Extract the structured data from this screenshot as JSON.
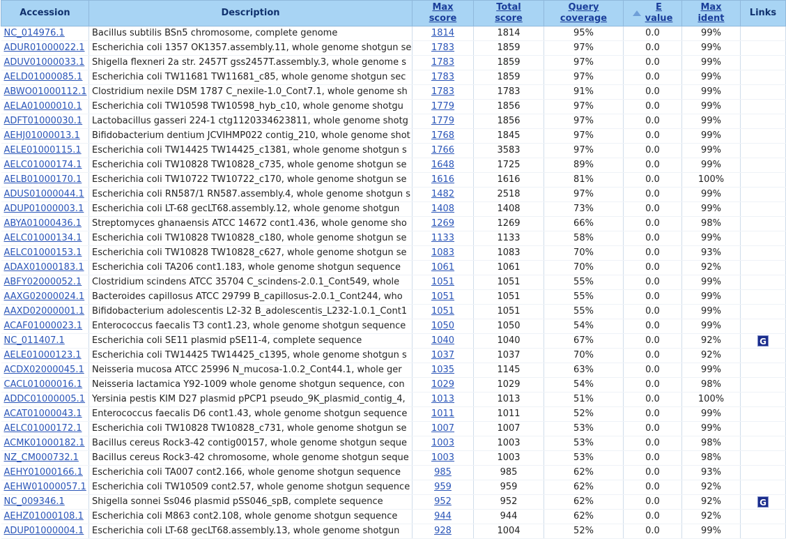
{
  "headers": {
    "accession": "Accession",
    "description": "Description",
    "max_score": [
      "Max",
      "score"
    ],
    "total_score": [
      "Total",
      "score"
    ],
    "query_coverage": [
      "Query",
      "coverage"
    ],
    "e_value": [
      "E",
      "value"
    ],
    "max_ident": [
      "Max",
      "ident"
    ],
    "links": "Links"
  },
  "rows": [
    {
      "accession": "NC_014976.1",
      "description": "Bacillus subtilis BSn5 chromosome, complete genome",
      "max_score": "1814",
      "total_score": "1814",
      "coverage": "95%",
      "evalue": "0.0",
      "ident": "99%",
      "link": ""
    },
    {
      "accession": "ADUR01000022.1",
      "description": "Escherichia coli 1357 OK1357.assembly.11, whole genome shotgun se",
      "max_score": "1783",
      "total_score": "1859",
      "coverage": "97%",
      "evalue": "0.0",
      "ident": "99%",
      "link": ""
    },
    {
      "accession": "ADUV01000033.1",
      "description": "Shigella flexneri 2a str. 2457T gss2457T.assembly.3, whole genome s",
      "max_score": "1783",
      "total_score": "1859",
      "coverage": "97%",
      "evalue": "0.0",
      "ident": "99%",
      "link": ""
    },
    {
      "accession": "AELD01000085.1",
      "description": "Escherichia coli TW11681 TW11681_c85, whole genome shotgun sec",
      "max_score": "1783",
      "total_score": "1859",
      "coverage": "97%",
      "evalue": "0.0",
      "ident": "99%",
      "link": ""
    },
    {
      "accession": "ABWO01000112.1",
      "description": "Clostridium nexile DSM 1787 C_nexile-1.0_Cont7.1, whole genome sh",
      "max_score": "1783",
      "total_score": "1783",
      "coverage": "91%",
      "evalue": "0.0",
      "ident": "99%",
      "link": ""
    },
    {
      "accession": "AELA01000010.1",
      "description": "Escherichia coli TW10598 TW10598_hyb_c10, whole genome shotgu",
      "max_score": "1779",
      "total_score": "1856",
      "coverage": "97%",
      "evalue": "0.0",
      "ident": "99%",
      "link": ""
    },
    {
      "accession": "ADFT01000030.1",
      "description": "Lactobacillus gasseri 224-1 ctg1120334623811, whole genome shotg",
      "max_score": "1779",
      "total_score": "1856",
      "coverage": "97%",
      "evalue": "0.0",
      "ident": "99%",
      "link": ""
    },
    {
      "accession": "AEHJ01000013.1",
      "description": "Bifidobacterium dentium JCVIHMP022 contig_210, whole genome shot",
      "max_score": "1768",
      "total_score": "1845",
      "coverage": "97%",
      "evalue": "0.0",
      "ident": "99%",
      "link": ""
    },
    {
      "accession": "AELE01000115.1",
      "description": "Escherichia coli TW14425 TW14425_c1381, whole genome shotgun s",
      "max_score": "1766",
      "total_score": "3583",
      "coverage": "97%",
      "evalue": "0.0",
      "ident": "99%",
      "link": ""
    },
    {
      "accession": "AELC01000174.1",
      "description": "Escherichia coli TW10828 TW10828_c735, whole genome shotgun se",
      "max_score": "1648",
      "total_score": "1725",
      "coverage": "89%",
      "evalue": "0.0",
      "ident": "99%",
      "link": ""
    },
    {
      "accession": "AELB01000170.1",
      "description": "Escherichia coli TW10722 TW10722_c170, whole genome shotgun se",
      "max_score": "1616",
      "total_score": "1616",
      "coverage": "81%",
      "evalue": "0.0",
      "ident": "100%",
      "link": ""
    },
    {
      "accession": "ADUS01000044.1",
      "description": "Escherichia coli RN587/1 RN587.assembly.4, whole genome shotgun s",
      "max_score": "1482",
      "total_score": "2518",
      "coverage": "97%",
      "evalue": "0.0",
      "ident": "99%",
      "link": ""
    },
    {
      "accession": "ADUP01000003.1",
      "description": "Escherichia coli LT-68 gecLT68.assembly.12, whole genome shotgun",
      "max_score": "1408",
      "total_score": "1408",
      "coverage": "73%",
      "evalue": "0.0",
      "ident": "99%",
      "link": ""
    },
    {
      "accession": "ABYA01000436.1",
      "description": "Streptomyces ghanaensis ATCC 14672 cont1.436, whole genome sho",
      "max_score": "1269",
      "total_score": "1269",
      "coverage": "66%",
      "evalue": "0.0",
      "ident": "98%",
      "link": ""
    },
    {
      "accession": "AELC01000134.1",
      "description": "Escherichia coli TW10828 TW10828_c180, whole genome shotgun se",
      "max_score": "1133",
      "total_score": "1133",
      "coverage": "58%",
      "evalue": "0.0",
      "ident": "99%",
      "link": ""
    },
    {
      "accession": "AELC01000153.1",
      "description": "Escherichia coli TW10828 TW10828_c627, whole genome shotgun se",
      "max_score": "1083",
      "total_score": "1083",
      "coverage": "70%",
      "evalue": "0.0",
      "ident": "93%",
      "link": ""
    },
    {
      "accession": "ADAX01000183.1",
      "description": "Escherichia coli TA206 cont1.183, whole genome shotgun sequence",
      "max_score": "1061",
      "total_score": "1061",
      "coverage": "70%",
      "evalue": "0.0",
      "ident": "92%",
      "link": ""
    },
    {
      "accession": "ABFY02000052.1",
      "description": "Clostridium scindens ATCC 35704 C_scindens-2.0.1_Cont549, whole",
      "max_score": "1051",
      "total_score": "1051",
      "coverage": "55%",
      "evalue": "0.0",
      "ident": "99%",
      "link": ""
    },
    {
      "accession": "AAXG02000024.1",
      "description": "Bacteroides capillosus ATCC 29799 B_capillosus-2.0.1_Cont244, who",
      "max_score": "1051",
      "total_score": "1051",
      "coverage": "55%",
      "evalue": "0.0",
      "ident": "99%",
      "link": ""
    },
    {
      "accession": "AAXD02000001.1",
      "description": "Bifidobacterium adolescentis L2-32 B_adolescentis_L232-1.0.1_Cont1",
      "max_score": "1051",
      "total_score": "1051",
      "coverage": "55%",
      "evalue": "0.0",
      "ident": "99%",
      "link": ""
    },
    {
      "accession": "ACAF01000023.1",
      "description": "Enterococcus faecalis T3 cont1.23, whole genome shotgun sequence",
      "max_score": "1050",
      "total_score": "1050",
      "coverage": "54%",
      "evalue": "0.0",
      "ident": "99%",
      "link": ""
    },
    {
      "accession": "NC_011407.1",
      "description": "Escherichia coli SE11 plasmid pSE11-4, complete sequence",
      "max_score": "1040",
      "total_score": "1040",
      "coverage": "67%",
      "evalue": "0.0",
      "ident": "92%",
      "link": "G"
    },
    {
      "accession": "AELE01000123.1",
      "description": "Escherichia coli TW14425 TW14425_c1395, whole genome shotgun s",
      "max_score": "1037",
      "total_score": "1037",
      "coverage": "70%",
      "evalue": "0.0",
      "ident": "92%",
      "link": ""
    },
    {
      "accession": "ACDX02000045.1",
      "description": "Neisseria mucosa ATCC 25996 N_mucosa-1.0.2_Cont44.1, whole ger",
      "max_score": "1035",
      "total_score": "1145",
      "coverage": "63%",
      "evalue": "0.0",
      "ident": "99%",
      "link": ""
    },
    {
      "accession": "CACL01000016.1",
      "description": "Neisseria lactamica Y92-1009 whole genome shotgun sequence, con",
      "max_score": "1029",
      "total_score": "1029",
      "coverage": "54%",
      "evalue": "0.0",
      "ident": "98%",
      "link": ""
    },
    {
      "accession": "ADDC01000005.1",
      "description": "Yersinia pestis KIM D27 plasmid pPCP1 pseudo_9K_plasmid_contig_4,",
      "max_score": "1013",
      "total_score": "1013",
      "coverage": "51%",
      "evalue": "0.0",
      "ident": "100%",
      "link": ""
    },
    {
      "accession": "ACAT01000043.1",
      "description": "Enterococcus faecalis D6 cont1.43, whole genome shotgun sequence",
      "max_score": "1011",
      "total_score": "1011",
      "coverage": "52%",
      "evalue": "0.0",
      "ident": "99%",
      "link": ""
    },
    {
      "accession": "AELC01000172.1",
      "description": "Escherichia coli TW10828 TW10828_c731, whole genome shotgun se",
      "max_score": "1007",
      "total_score": "1007",
      "coverage": "53%",
      "evalue": "0.0",
      "ident": "99%",
      "link": ""
    },
    {
      "accession": "ACMK01000182.1",
      "description": "Bacillus cereus Rock3-42 contig00157, whole genome shotgun seque",
      "max_score": "1003",
      "total_score": "1003",
      "coverage": "53%",
      "evalue": "0.0",
      "ident": "98%",
      "link": ""
    },
    {
      "accession": "NZ_CM000732.1",
      "description": "Bacillus cereus Rock3-42 chromosome, whole genome shotgun seque",
      "max_score": "1003",
      "total_score": "1003",
      "coverage": "53%",
      "evalue": "0.0",
      "ident": "98%",
      "link": ""
    },
    {
      "accession": "AEHY01000166.1",
      "description": "Escherichia coli TA007 cont2.166, whole genome shotgun sequence",
      "max_score": "985",
      "total_score": "985",
      "coverage": "62%",
      "evalue": "0.0",
      "ident": "93%",
      "link": ""
    },
    {
      "accession": "AEHW01000057.1",
      "description": "Escherichia coli TW10509 cont2.57, whole genome shotgun sequence",
      "max_score": "959",
      "total_score": "959",
      "coverage": "62%",
      "evalue": "0.0",
      "ident": "92%",
      "link": ""
    },
    {
      "accession": "NC_009346.1",
      "description": "Shigella sonnei Ss046 plasmid pSS046_spB, complete sequence",
      "max_score": "952",
      "total_score": "952",
      "coverage": "62%",
      "evalue": "0.0",
      "ident": "92%",
      "link": "G"
    },
    {
      "accession": "AEHZ01000108.1",
      "description": "Escherichia coli M863 cont2.108, whole genome shotgun sequence",
      "max_score": "944",
      "total_score": "944",
      "coverage": "62%",
      "evalue": "0.0",
      "ident": "92%",
      "link": ""
    },
    {
      "accession": "ADUP01000004.1",
      "description": "Escherichia coli LT-68 gecLT68.assembly.13, whole genome shotgun",
      "max_score": "928",
      "total_score": "1004",
      "coverage": "52%",
      "evalue": "0.0",
      "ident": "99%",
      "link": ""
    }
  ]
}
